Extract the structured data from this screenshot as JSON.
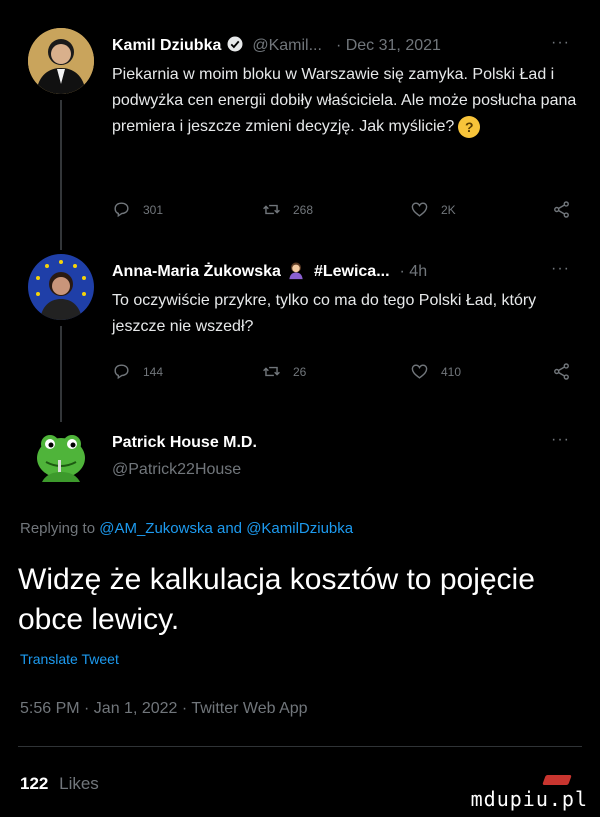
{
  "tweets": [
    {
      "name": "Kamil Dziubka",
      "handle": "@Kamil...",
      "date": "· Dec 31, 2021",
      "more": "···",
      "text": "Piekarnia w moim bloku w Warszawie się zamyka. Polski Ład i podwyżka cen energii dobiły właściciela. Ale może posłucha pana premiera i jeszcze zmieni decyzję. Jak myślicie?",
      "emoji": "?",
      "replies": "301",
      "retweets": "268",
      "likes": "2K"
    },
    {
      "name": "Anna-Maria Żukowska",
      "handle": "#Lewica...",
      "date": "· 4h",
      "more": "···",
      "text": "To oczywiście przykre, tylko co ma do tego Polski Ład, który jeszcze nie wszedł?",
      "replies": "144",
      "retweets": "26",
      "likes": "410"
    }
  ],
  "main_tweet": {
    "name": "Patrick House M.D.",
    "handle": "@Patrick22House",
    "more": "···",
    "replying_prefix": "Replying to",
    "reply_user_1": "@AM_Zukowska",
    "reply_and": "and",
    "reply_user_2": "@KamilDziubka",
    "text": "Widzę że kalkulacja kosztów to pojęcie obce lewicy.",
    "translate": "Translate Tweet",
    "meta": "5:56 PM · Jan 1, 2022 · Twitter Web App",
    "likes_count": "122",
    "likes_label": "Likes"
  },
  "watermark": "mdupiu.pl",
  "colors": {
    "background": "#000000",
    "link": "#1d9bf0",
    "muted": "#71767b",
    "text": "#e7e9ea",
    "verified": "#1d9bf0"
  },
  "icons": [
    "reply-icon",
    "retweet-icon",
    "like-icon",
    "share-icon",
    "verified-badge-icon",
    "emoji-icon",
    "more-icon"
  ]
}
